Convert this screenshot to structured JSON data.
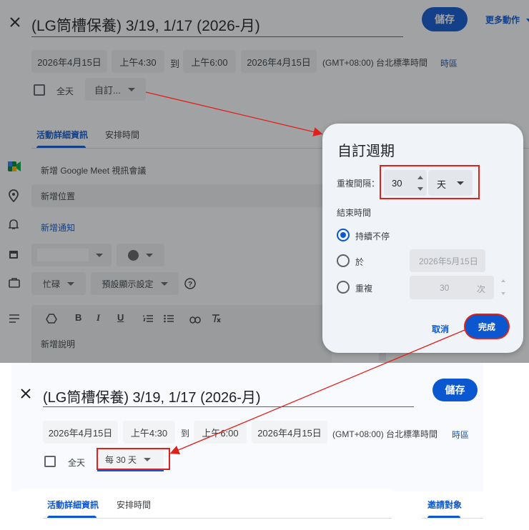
{
  "top_panel": {
    "title": "(LG筒槽保養) 3/19, 1/17 (2026-月)",
    "save_label": "儲存",
    "more_actions": "更多動作",
    "start_date": "2026年4月15日",
    "start_time": "上午4:30",
    "to_label": "到",
    "end_time": "上午6:00",
    "end_date": "2026年4月15日",
    "timezone": "(GMT+08:00) 台北標準時間",
    "timezone_link": "時區",
    "all_day": "全天",
    "recurrence_value": "自訂...",
    "tabs": [
      "活動詳細資訊",
      "安排時間"
    ],
    "meet_label": "新增 Google Meet 視訊會議",
    "location_placeholder": "新增位置",
    "notification_link": "新增通知",
    "busy_label": "忙碌",
    "visibility_label": "預設顯示設定",
    "description_placeholder": "新增說明"
  },
  "dialog": {
    "title": "自訂週期",
    "repeat_every_label": "重複間隔：",
    "interval_value": "30",
    "unit_value": "天",
    "ends_label": "結束時間",
    "options": [
      {
        "label": "持續不停",
        "selected": true
      },
      {
        "label": "於",
        "selected": false
      },
      {
        "label": "重複",
        "selected": false
      }
    ],
    "on_date": "2026年5月15日",
    "occurrences_value": "30",
    "occurrences_unit": "次",
    "cancel_label": "取消",
    "done_label": "完成"
  },
  "bottom_panel": {
    "title": "(LG筒槽保養) 3/19, 1/17 (2026-月)",
    "save_label": "儲存",
    "start_date": "2026年4月15日",
    "start_time": "上午4:30",
    "to_label": "到",
    "end_time": "上午6:00",
    "end_date": "2026年4月15日",
    "timezone": "(GMT+08:00) 台北標準時間",
    "timezone_link": "時區",
    "all_day": "全天",
    "recurrence_value": "每 30 天",
    "tabs": [
      "活動詳細資訊",
      "安排時間"
    ],
    "guests_tab": "邀請對象"
  },
  "colors": {
    "accent": "#0b57d0",
    "annotation_red": "#e0201b",
    "dialog_bg": "#f0f4f9"
  }
}
